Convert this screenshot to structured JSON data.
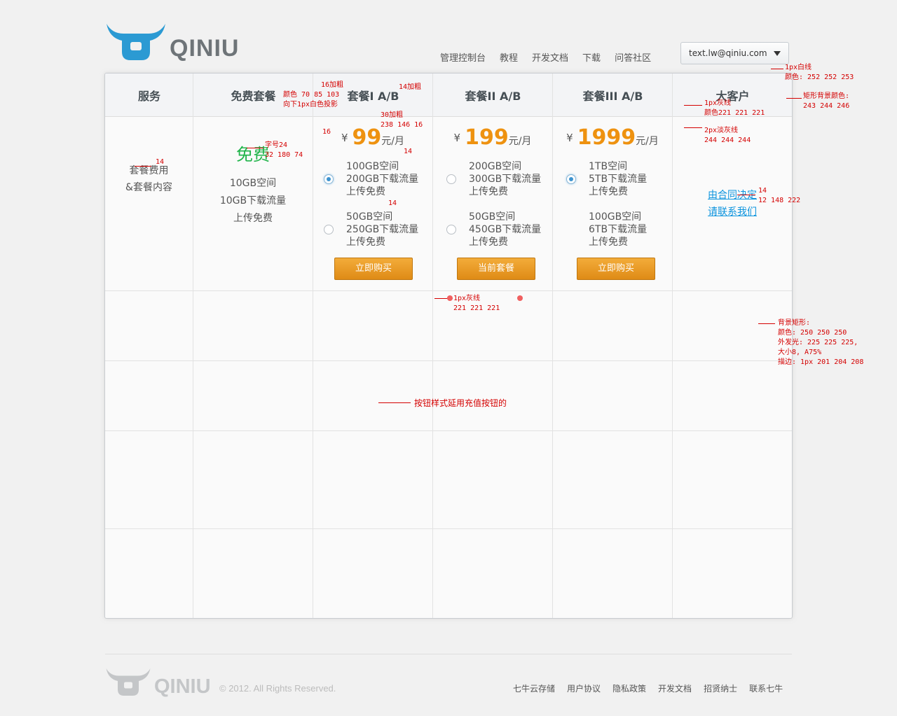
{
  "brand": {
    "name": "QINIU"
  },
  "nav": {
    "items": [
      "管理控制台",
      "教程",
      "开发文档",
      "下载",
      "问答社区"
    ]
  },
  "account": {
    "email": "text.lw@qiniu.com",
    "menu_icon": "caret-down-icon"
  },
  "table": {
    "headers": [
      "服务",
      "免费套餐",
      "套餐I A/B",
      "套餐II A/B",
      "套餐III A/B",
      "大客户"
    ],
    "service_label": [
      "套餐费用",
      "&套餐内容"
    ],
    "free": {
      "title": "免费",
      "features": [
        "10GB空间",
        "10GB下载流量",
        "上传免费"
      ]
    },
    "plans": [
      {
        "currency": "¥",
        "price": "99",
        "unit": "元/月",
        "options": [
          {
            "lines": [
              "100GB空间",
              "200GB下载流量",
              "上传免费"
            ],
            "selected": true
          },
          {
            "lines": [
              "50GB空间",
              "250GB下载流量",
              "上传免费"
            ],
            "selected": false
          }
        ],
        "button": "立即购买"
      },
      {
        "currency": "¥",
        "price": "199",
        "unit": "元/月",
        "options": [
          {
            "lines": [
              "200GB空间",
              "300GB下载流量",
              "上传免费"
            ],
            "selected": false
          },
          {
            "lines": [
              "50GB空间",
              "450GB下载流量",
              "上传免费"
            ],
            "selected": false
          }
        ],
        "button": "当前套餐"
      },
      {
        "currency": "¥",
        "price": "1999",
        "unit": "元/月",
        "options": [
          {
            "lines": [
              "1TB空间",
              "5TB下载流量",
              "上传免费"
            ],
            "selected": true
          },
          {
            "lines": [
              "100GB空间",
              "6TB下载流量",
              "上传免费"
            ],
            "selected": false
          }
        ],
        "button": "立即购买"
      }
    ],
    "enterprise": {
      "line1": "由合同决定",
      "line2": "请联系我们"
    }
  },
  "annotations": {
    "a1": "1px白线\n颜色: 252 252 253",
    "a2": "矩形背景颜色:\n243 244 246",
    "a3": "1px灰线\n颜色221 221 221",
    "a4": "2px淡灰线\n244 244 244",
    "a5": "16加粗",
    "a6": "颜色 70 85 103\n向下1px白色投影",
    "a7": "14加粗",
    "a8": "30加粗\n238 146 16",
    "a9": "16",
    "a10": "14",
    "a11": "字号24\n32 180 74",
    "a12": "14",
    "a13": "14",
    "a14": "14\n12 148 222",
    "a15": "1px灰线\n221 221 221",
    "a16": "背景矩形:\n颜色: 250 250 250\n外发光: 225 225 225,\n大小8, A75%\n描边: 1px 201 204 208",
    "a17": "按钮样式延用充值按钮的"
  },
  "footer": {
    "copyright": "© 2012. All Rights Reserved.",
    "links": [
      "七牛云存储",
      "用户协议",
      "隐私政策",
      "开发文档",
      "招贤纳士",
      "联系七牛"
    ]
  },
  "colors": {
    "price": "#ee9210",
    "free": "#20b44a",
    "link": "#0c94de",
    "annotation": "#d40000"
  }
}
